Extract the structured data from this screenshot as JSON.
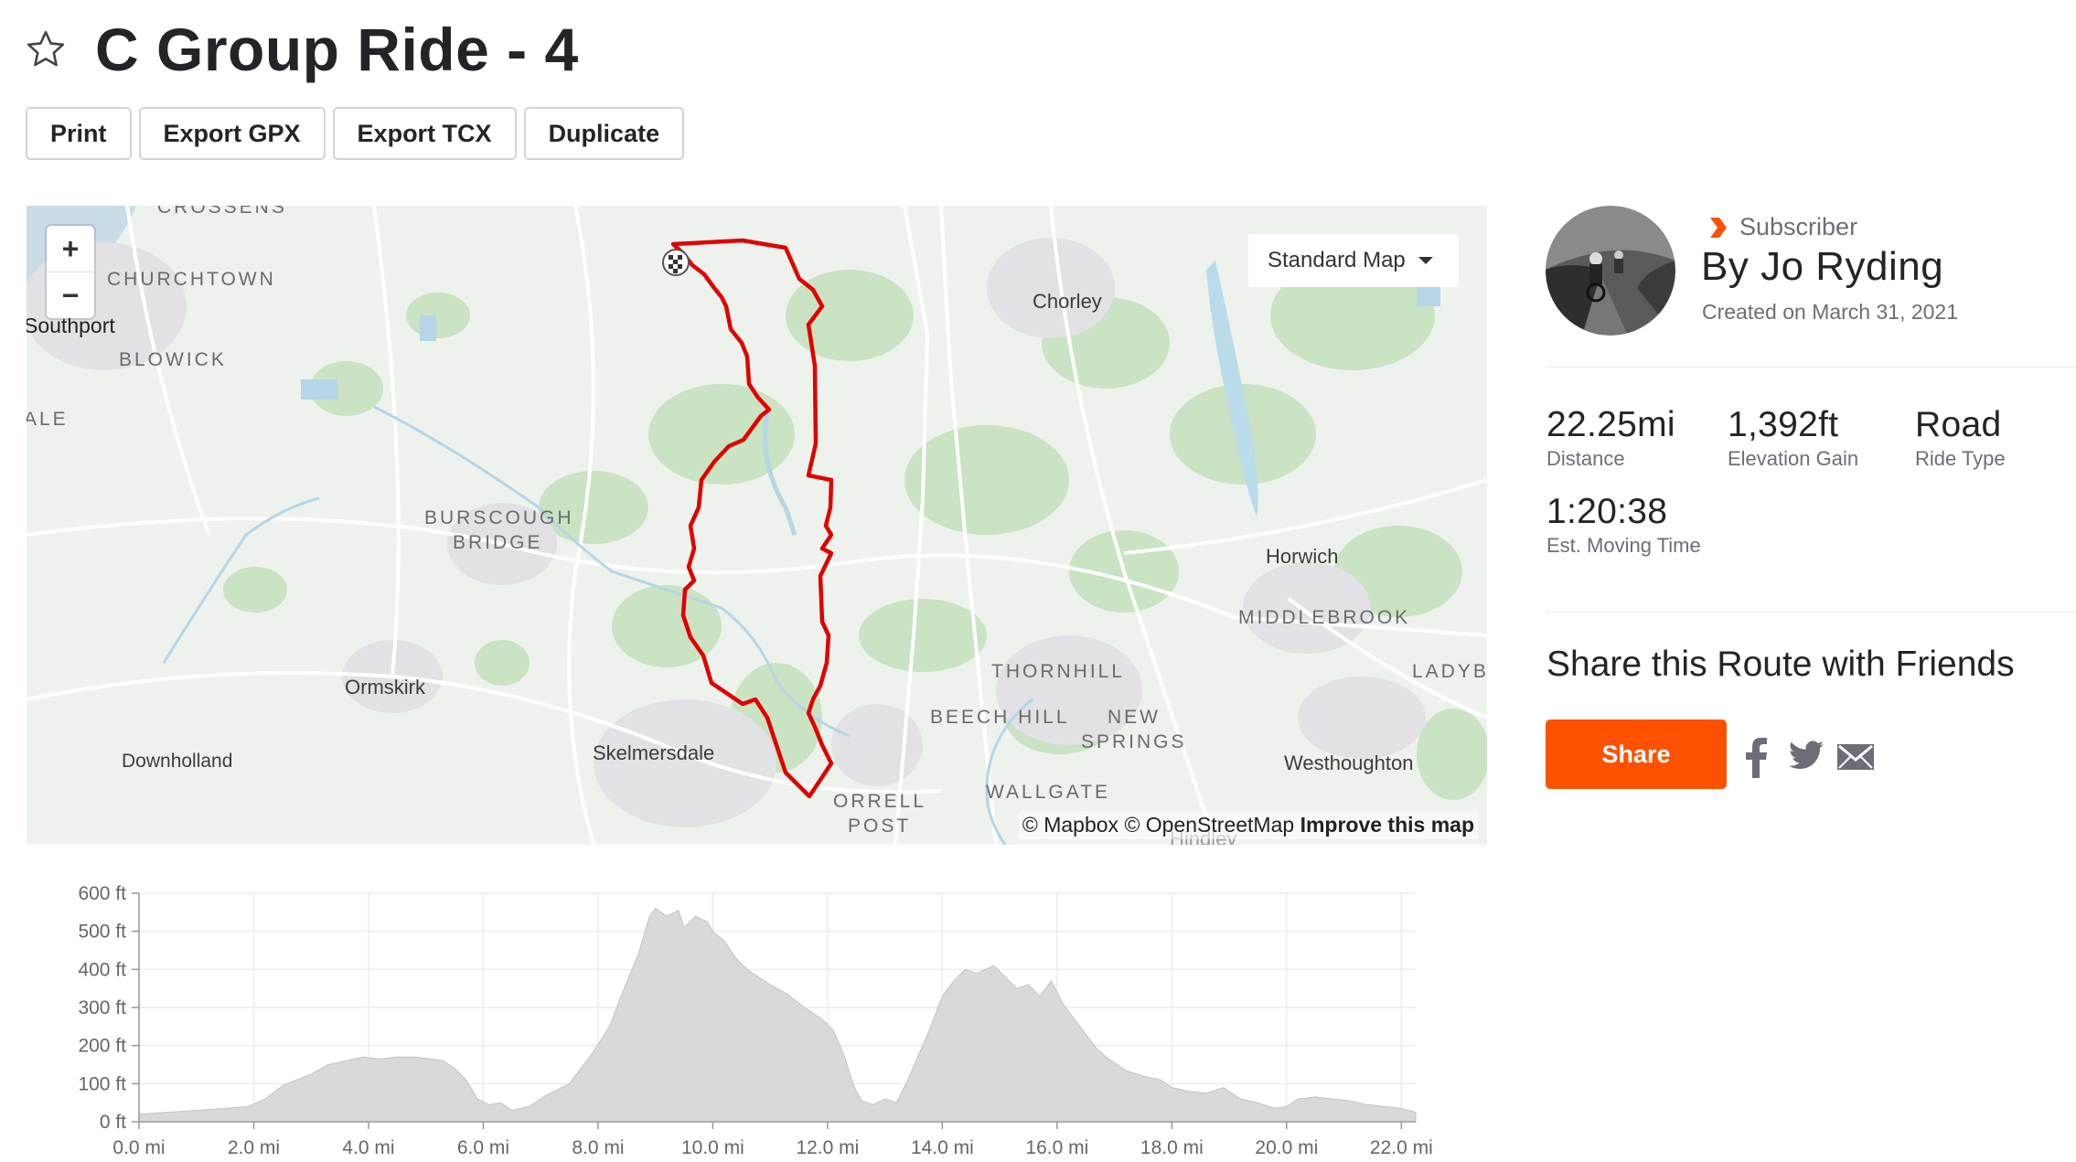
{
  "route": {
    "title": "C Group Ride - 4"
  },
  "actions": {
    "print": "Print",
    "export_gpx": "Export GPX",
    "export_tcx": "Export TCX",
    "duplicate": "Duplicate"
  },
  "map": {
    "zoom_in": "+",
    "zoom_out": "−",
    "style_selector": "Standard Map",
    "attribution_mapbox": "© Mapbox",
    "attribution_osm": "© OpenStreetMap",
    "attribution_improve": "Improve this map",
    "labels": {
      "crossens": "CROSSENS",
      "churchtown": "CHURCHTOWN",
      "southport": "Southport",
      "blowick": "BLOWICK",
      "ale": "ALE",
      "chorley": "Chorley",
      "burscough_1": "BURSCOUGH",
      "burscough_2": "BRIDGE",
      "horwich": "Horwich",
      "middlebrook": "MIDDLEBROOK",
      "ladybi": "LADYBI",
      "ormskirk": "Ormskirk",
      "thornhill": "THORNHILL",
      "beech_hill": "BEECH HILL",
      "new_springs_1": "NEW",
      "new_springs_2": "SPRINGS",
      "downholland": "Downholland",
      "skelmersdale": "Skelmersdale",
      "westhoughton": "Westhoughton",
      "wallgate": "WALLGATE",
      "orrell_1": "ORRELL",
      "orrell_2": "POST",
      "hindley": "Hindley"
    },
    "route_color": "#e00000"
  },
  "creator": {
    "badge": "Subscriber",
    "name": "By Jo Ryding",
    "created": "Created on March 31, 2021"
  },
  "stats": {
    "distance": {
      "value": "22.25mi",
      "label": "Distance"
    },
    "elevation": {
      "value": "1,392ft",
      "label": "Elevation Gain"
    },
    "type": {
      "value": "Road",
      "label": "Ride Type"
    },
    "time": {
      "value": "1:20:38",
      "label": "Est. Moving Time"
    }
  },
  "share": {
    "title": "Share this Route with Friends",
    "button": "Share",
    "icons": [
      "facebook-icon",
      "twitter-icon",
      "email-icon"
    ]
  },
  "colors": {
    "brand": "#fc5200",
    "route": "#e00000",
    "profile_fill": "#d9d9d9"
  },
  "chart_data": {
    "type": "area",
    "title": "",
    "xlabel": "",
    "ylabel": "",
    "xlim": [
      0,
      22.25
    ],
    "ylim": [
      0,
      600
    ],
    "x_ticks": [
      "0.0 mi",
      "2.0 mi",
      "4.0 mi",
      "6.0 mi",
      "8.0 mi",
      "10.0 mi",
      "12.0 mi",
      "14.0 mi",
      "16.0 mi",
      "18.0 mi",
      "20.0 mi",
      "22.0 mi"
    ],
    "y_ticks": [
      "0 ft",
      "100 ft",
      "200 ft",
      "300 ft",
      "400 ft",
      "500 ft",
      "600 ft"
    ],
    "grid": true,
    "series": [
      {
        "x": [
          0,
          0.5,
          1.0,
          1.5,
          1.9,
          2.2,
          2.5,
          3.0,
          3.3,
          3.6,
          3.9,
          4.2,
          4.5,
          4.8,
          5.1,
          5.3,
          5.5,
          5.7,
          5.9,
          6.1,
          6.3,
          6.5,
          6.8,
          7.1,
          7.5,
          7.9,
          8.2,
          8.4,
          8.7,
          8.9,
          9.0,
          9.2,
          9.4,
          9.5,
          9.7,
          9.9,
          10.0,
          10.2,
          10.4,
          10.6,
          10.8,
          11.0,
          11.3,
          11.6,
          11.9,
          12.1,
          12.3,
          12.4,
          12.5,
          12.6,
          12.8,
          13.0,
          13.2,
          13.4,
          13.6,
          13.8,
          14.0,
          14.2,
          14.4,
          14.6,
          14.9,
          15.1,
          15.3,
          15.5,
          15.7,
          15.9,
          16.1,
          16.3,
          16.5,
          16.7,
          16.9,
          17.2,
          17.5,
          17.8,
          18.0,
          18.3,
          18.6,
          18.9,
          19.2,
          19.5,
          19.8,
          20.0,
          20.2,
          20.5,
          20.8,
          21.1,
          21.4,
          21.7,
          22.0,
          22.25
        ],
        "y": [
          20,
          25,
          30,
          35,
          40,
          60,
          95,
          125,
          150,
          160,
          170,
          165,
          170,
          170,
          165,
          160,
          140,
          110,
          60,
          45,
          50,
          30,
          40,
          70,
          100,
          180,
          250,
          330,
          440,
          540,
          560,
          540,
          555,
          510,
          540,
          525,
          500,
          475,
          430,
          400,
          380,
          360,
          335,
          300,
          270,
          240,
          170,
          120,
          80,
          55,
          45,
          60,
          50,
          110,
          180,
          250,
          330,
          370,
          400,
          390,
          410,
          380,
          350,
          360,
          330,
          370,
          310,
          270,
          230,
          190,
          165,
          135,
          120,
          110,
          90,
          80,
          75,
          90,
          60,
          50,
          35,
          40,
          60,
          65,
          60,
          55,
          45,
          40,
          35,
          25
        ]
      }
    ]
  }
}
